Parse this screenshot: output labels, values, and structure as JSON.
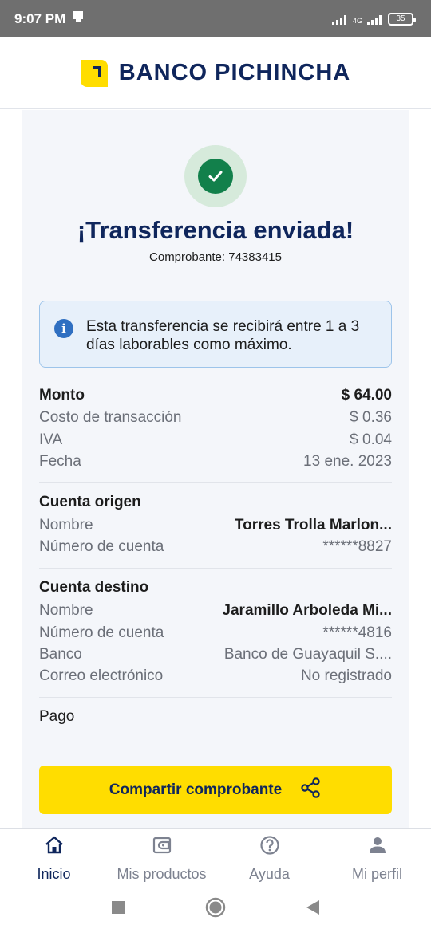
{
  "status_bar": {
    "time": "9:07 PM",
    "network": "4G",
    "battery": "35"
  },
  "header": {
    "brand": "BANCO PICHINCHA"
  },
  "confirmation": {
    "title": "¡Transferencia enviada!",
    "receipt": "Comprobante: 74383415",
    "info": "Esta transferencia se recibirá entre 1 a 3 días laborables como máximo."
  },
  "summary": {
    "monto_label": "Monto",
    "monto_value": "$ 64.00",
    "costo_label": "Costo de transacción",
    "costo_value": "$ 0.36",
    "iva_label": "IVA",
    "iva_value": "$ 0.04",
    "fecha_label": "Fecha",
    "fecha_value": "13 ene. 2023"
  },
  "origen": {
    "title": "Cuenta origen",
    "nombre_label": "Nombre",
    "nombre_value": "Torres  Trolla Marlon...",
    "cuenta_label": "Número de cuenta",
    "cuenta_value": "******8827"
  },
  "destino": {
    "title": "Cuenta destino",
    "nombre_label": "Nombre",
    "nombre_value": "Jaramillo Arboleda Mi...",
    "cuenta_label": "Número de cuenta",
    "cuenta_value": "******4816",
    "banco_label": "Banco",
    "banco_value": "Banco de Guayaquil S....",
    "correo_label": "Correo electrónico",
    "correo_value": "No registrado"
  },
  "concepto": "Pago",
  "share_button": "Compartir comprobante",
  "bottom_nav": {
    "items": [
      {
        "label": "Inicio",
        "icon": "home-icon"
      },
      {
        "label": "Mis productos",
        "icon": "wallet-icon"
      },
      {
        "label": "Ayuda",
        "icon": "help-icon"
      },
      {
        "label": "Mi perfil",
        "icon": "person-icon"
      }
    ]
  },
  "colors": {
    "brand_navy": "#0f265c",
    "brand_yellow": "#ffdd00",
    "success_green": "#12804b",
    "info_blue": "#2f6fc1"
  }
}
